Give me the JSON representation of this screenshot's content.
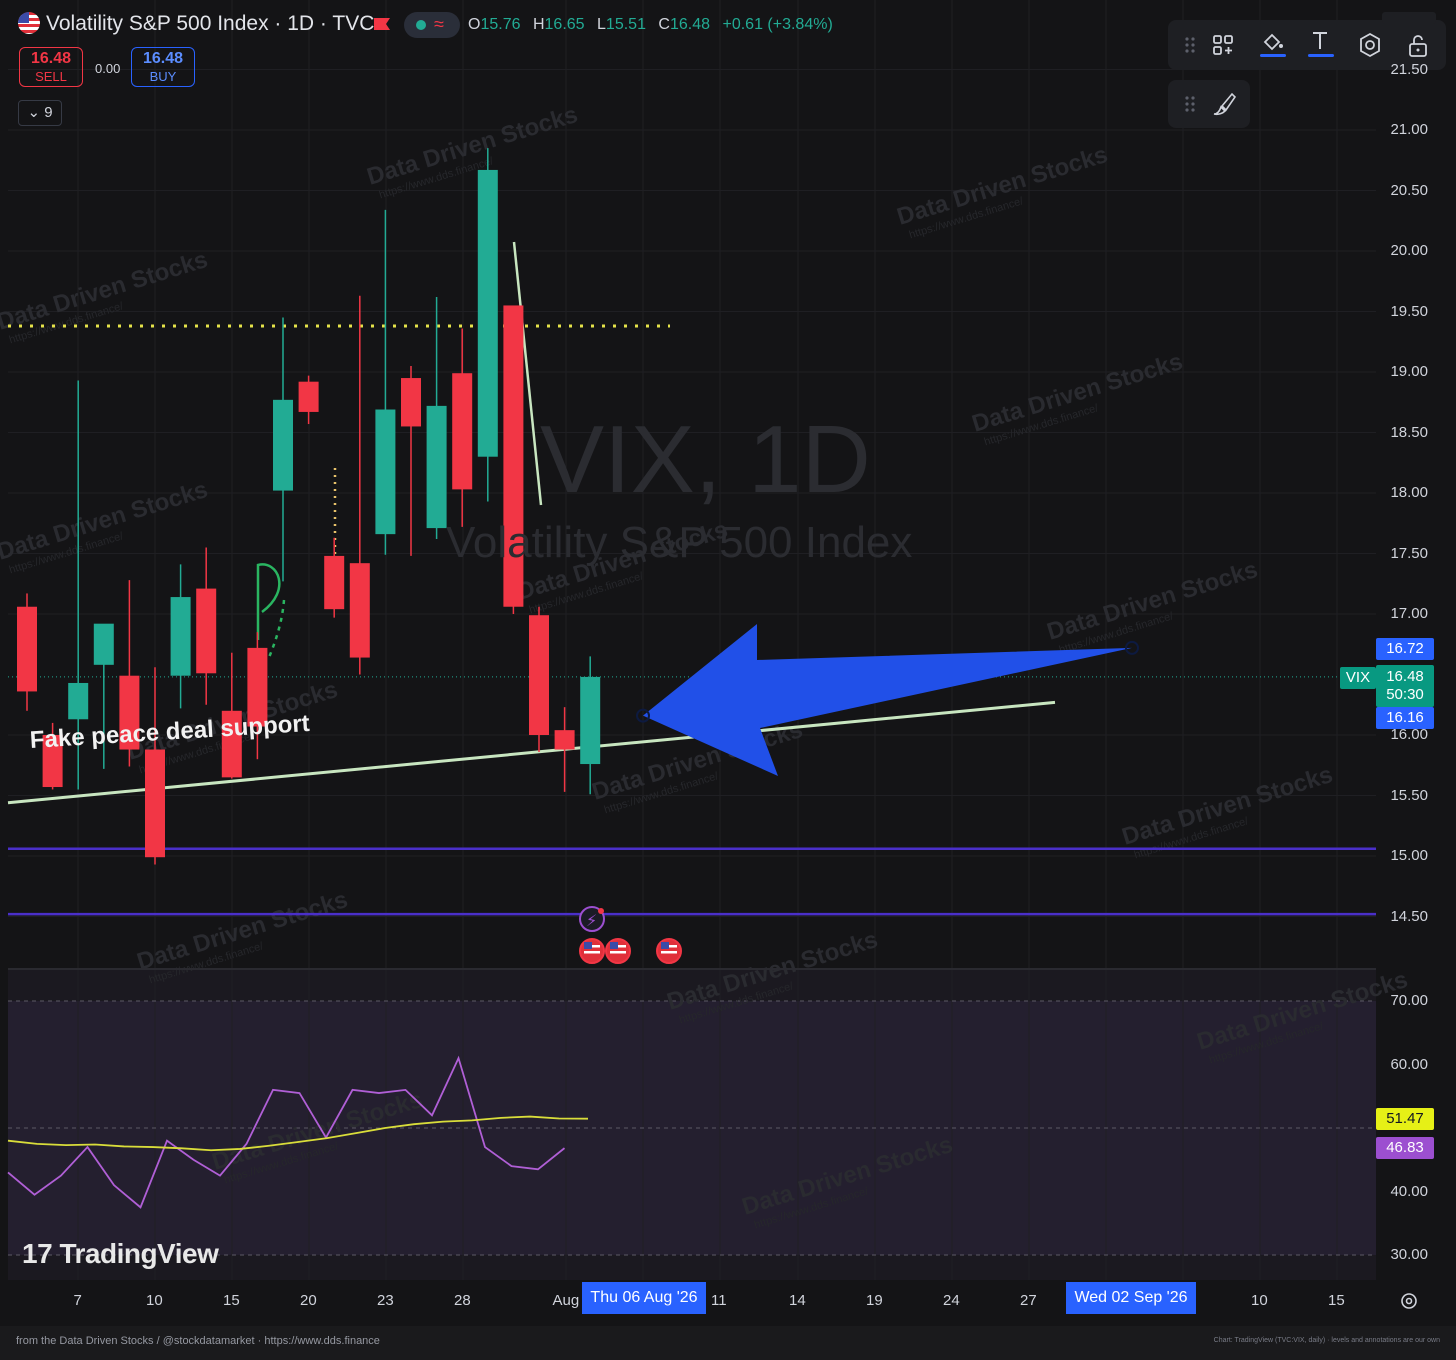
{
  "header": {
    "symbol_title": "Volatility S&P 500 Index · 1D · TVC",
    "ohlc": {
      "o_label": "O",
      "o_value": "15.76",
      "h_label": "H",
      "h_value": "16.65",
      "l_label": "L",
      "l_value": "15.51",
      "c_label": "C",
      "c_value": "16.48",
      "change": "+0.61 (+3.84%)"
    },
    "sell_price": "16.48",
    "sell_label": "SELL",
    "spread": "0.00",
    "buy_price": "16.48",
    "buy_label": "BUY",
    "indicators_collapsed_count": "9"
  },
  "watermark": {
    "symbol": "VIX, 1D",
    "name": "Volatility S&P 500 Index",
    "brand": "Data Driven Stocks",
    "url": "https://www.dds.finance/"
  },
  "annotation_text": "Fake peace deal support",
  "price_axis": {
    "ticks": [
      "21.50",
      "21.00",
      "20.50",
      "20.00",
      "19.50",
      "19.00",
      "18.50",
      "18.00",
      "17.50",
      "17.00",
      "16.00",
      "15.50",
      "15.00",
      "14.50"
    ],
    "badge_high": "16.72",
    "badge_symbol": "VIX",
    "badge_price": "16.48",
    "badge_countdown": "50:30",
    "badge_low": "16.16"
  },
  "rsi_axis": {
    "ticks": [
      "70.00",
      "60.00",
      "40.00",
      "30.00"
    ],
    "badge_ma": "51.47",
    "badge_rsi": "46.83"
  },
  "time_axis": {
    "ticks": [
      "7",
      "10",
      "15",
      "20",
      "23",
      "28",
      "Aug",
      "11",
      "14",
      "19",
      "24",
      "27",
      "10",
      "15"
    ],
    "highlight_start": "Thu 06 Aug '26",
    "highlight_end": "Wed 02 Sep '26"
  },
  "branding": {
    "logo": "TradingView"
  },
  "footer": {
    "left": "from the Data Driven Stocks / @stockdatamarket   ·   https://www.dds.finance",
    "right": "Chart: TradingView (TVC:VIX, daily) · levels and annotations are our own"
  },
  "colors": {
    "up": "#22ab94",
    "down": "#f23645",
    "arrow": "#2150e8",
    "support": "#c8e6c0",
    "resistance_dotted": "#e6e34a",
    "level_lines": "#4a2fc9",
    "rsi": "#b05fd6",
    "rsi_ma": "#d9dd3a"
  },
  "chart_data": {
    "type": "candlestick",
    "y_range": [
      14.2,
      21.55
    ],
    "candles": [
      {
        "o": 17.06,
        "h": 17.17,
        "l": 16.2,
        "c": 16.36
      },
      {
        "o": 16.0,
        "h": 16.1,
        "l": 15.55,
        "c": 15.57
      },
      {
        "o": 16.13,
        "h": 18.93,
        "l": 15.55,
        "c": 16.43
      },
      {
        "o": 16.58,
        "h": 16.68,
        "l": 15.72,
        "c": 16.92
      },
      {
        "o": 16.49,
        "h": 17.28,
        "l": 15.74,
        "c": 15.88
      },
      {
        "o": 15.88,
        "h": 16.56,
        "l": 14.93,
        "c": 14.99
      },
      {
        "o": 16.49,
        "h": 17.41,
        "l": 16.22,
        "c": 17.14
      },
      {
        "o": 17.21,
        "h": 17.55,
        "l": 16.25,
        "c": 16.51
      },
      {
        "o": 16.2,
        "h": 16.68,
        "l": 15.64,
        "c": 15.65
      },
      {
        "o": 16.72,
        "h": 16.85,
        "l": 15.8,
        "c": 16.07
      },
      {
        "o": 18.02,
        "h": 19.45,
        "l": 17.27,
        "c": 18.77
      },
      {
        "o": 18.92,
        "h": 18.97,
        "l": 18.57,
        "c": 18.67
      },
      {
        "o": 17.48,
        "h": 17.63,
        "l": 16.97,
        "c": 17.04
      },
      {
        "o": 17.42,
        "h": 19.63,
        "l": 16.5,
        "c": 16.64
      },
      {
        "o": 17.66,
        "h": 20.34,
        "l": 17.49,
        "c": 18.69
      },
      {
        "o": 18.95,
        "h": 19.05,
        "l": 17.48,
        "c": 18.55
      },
      {
        "o": 17.71,
        "h": 19.62,
        "l": 17.62,
        "c": 18.72
      },
      {
        "o": 18.99,
        "h": 19.36,
        "l": 17.72,
        "c": 18.03
      },
      {
        "o": 18.3,
        "h": 20.85,
        "l": 17.93,
        "c": 20.67
      },
      {
        "o": 19.55,
        "h": 19.55,
        "l": 17.0,
        "c": 17.06
      },
      {
        "o": 16.99,
        "h": 17.06,
        "l": 15.86,
        "c": 16.0
      },
      {
        "o": 16.04,
        "h": 16.23,
        "l": 15.53,
        "c": 15.88
      },
      {
        "o": 15.76,
        "h": 16.65,
        "l": 15.51,
        "c": 16.48
      }
    ],
    "levels": {
      "dotted_resistance": 19.38,
      "support_lines": [
        15.06,
        14.52
      ],
      "rising_support": [
        15.44,
        16.27
      ],
      "arrow_tail": 16.72,
      "arrow_tip": 16.16
    },
    "rsi": {
      "range": [
        25,
        75
      ],
      "rsi_values": [
        43,
        39.5,
        42.5,
        47,
        41,
        37.5,
        48,
        45,
        42.5,
        47.5,
        56,
        55.5,
        48.5,
        56,
        55.5,
        56,
        52,
        61,
        47,
        44,
        43.5,
        46.83
      ],
      "ma_values": [
        48,
        47.5,
        47.3,
        47.4,
        47.1,
        47.0,
        46.8,
        46.5,
        46.7,
        47.2,
        47.8,
        48.4,
        49.2,
        50.0,
        50.6,
        51.0,
        51.2,
        51.6,
        51.8,
        51.5,
        51.47
      ]
    }
  }
}
